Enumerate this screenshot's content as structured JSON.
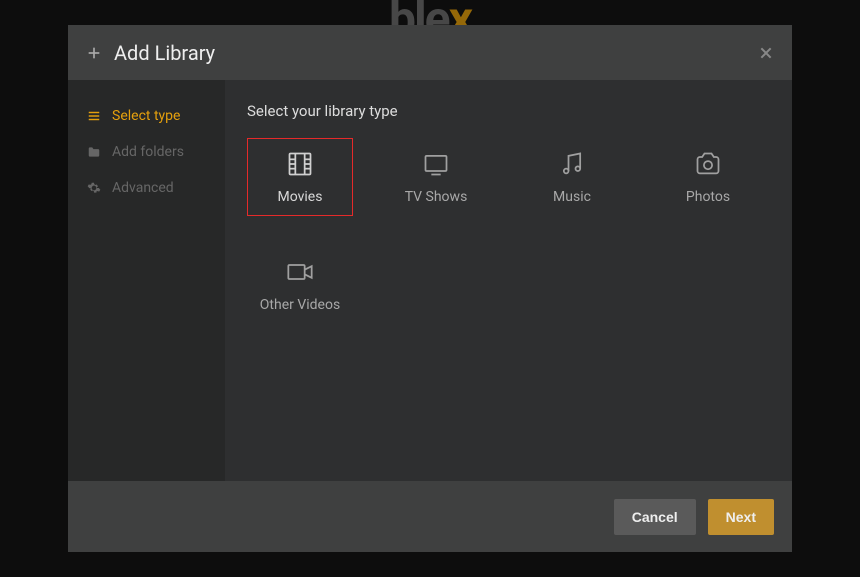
{
  "header": {
    "title": "Add Library"
  },
  "sidebar": {
    "items": [
      {
        "label": "Select type",
        "icon": "list-icon",
        "active": true
      },
      {
        "label": "Add folders",
        "icon": "folder-icon",
        "active": false
      },
      {
        "label": "Advanced",
        "icon": "gear-icon",
        "active": false
      }
    ]
  },
  "main": {
    "heading": "Select your library type",
    "types": [
      {
        "label": "Movies",
        "icon": "film-icon",
        "selected": true
      },
      {
        "label": "TV Shows",
        "icon": "tv-icon",
        "selected": false
      },
      {
        "label": "Music",
        "icon": "music-icon",
        "selected": false
      },
      {
        "label": "Photos",
        "icon": "camera-icon",
        "selected": false
      },
      {
        "label": "Other Videos",
        "icon": "video-icon",
        "selected": false
      }
    ]
  },
  "footer": {
    "cancel": "Cancel",
    "next": "Next"
  },
  "colors": {
    "accent": "#e5a00d",
    "highlight": "#e52a2a"
  }
}
